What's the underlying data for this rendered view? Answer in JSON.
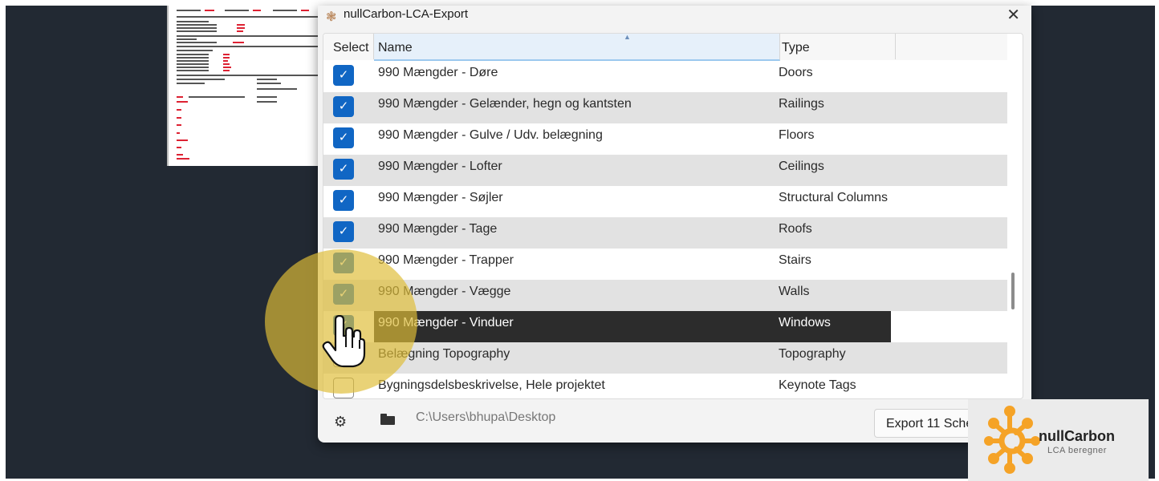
{
  "window": {
    "title": "nullCarbon-LCA-Export",
    "close_symbol": "✕"
  },
  "table": {
    "headers": {
      "select": "Select",
      "name": "Name",
      "type": "Type"
    },
    "sorted_column": "Name",
    "rows": [
      {
        "checked": true,
        "name": "990 Mængder - Døre",
        "type": "Doors"
      },
      {
        "checked": true,
        "name": "990 Mængder - Gelænder, hegn og kantsten",
        "type": "Railings"
      },
      {
        "checked": true,
        "name": "990 Mængder - Gulve / Udv. belægning",
        "type": "Floors"
      },
      {
        "checked": true,
        "name": "990 Mængder - Lofter",
        "type": "Ceilings"
      },
      {
        "checked": true,
        "name": "990 Mængder - Søjler",
        "type": "Structural Columns"
      },
      {
        "checked": true,
        "name": "990 Mængder - Tage",
        "type": "Roofs"
      },
      {
        "checked": true,
        "name": "990 Mængder - Trapper",
        "type": "Stairs"
      },
      {
        "checked": true,
        "name": "990 Mængder - Vægge",
        "type": "Walls"
      },
      {
        "checked": true,
        "name": "990 Mængder - Vinduer",
        "type": "Windows",
        "selected": true
      },
      {
        "checked": false,
        "name": "Belægning Topography",
        "type": "Topography"
      },
      {
        "checked": false,
        "name": "Bygningsdelsbeskrivelse, Hele projektet",
        "type": "Keynote Tags"
      }
    ]
  },
  "footer": {
    "path": "C:\\Users\\bhupa\\Desktop",
    "export_label": "Export 11 Schedules",
    "settings_icon": "gear-icon",
    "folder_icon": "folder-icon"
  },
  "logo": {
    "name": "nullCarbon",
    "tagline": "LCA beregner"
  },
  "colors": {
    "checkbox": "#1066c4",
    "selected_row": "#2c2c2c",
    "highlight": "#dfbc37",
    "brand_orange": "#f5a327"
  }
}
